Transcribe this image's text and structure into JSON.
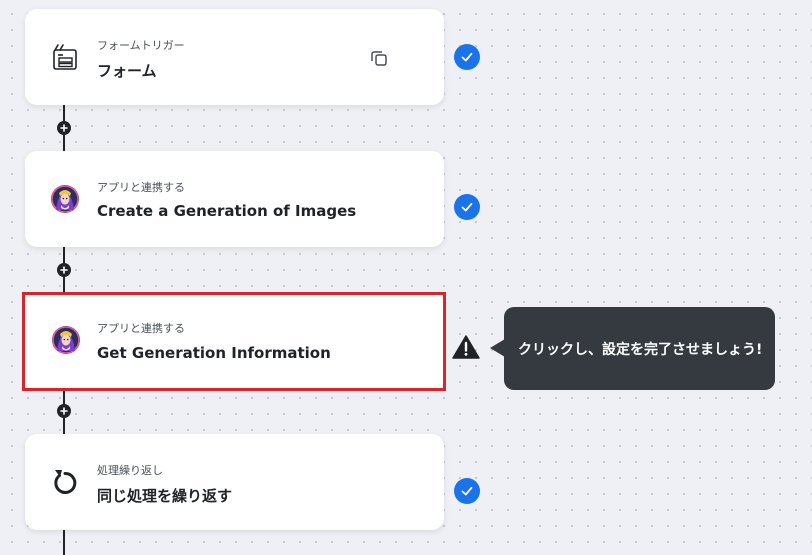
{
  "steps": [
    {
      "subtitle": "フォームトリガー",
      "title": "フォーム",
      "icon": "form-trigger-icon",
      "status": "complete"
    },
    {
      "subtitle": "アプリと連携する",
      "title": "Create a Generation of Images",
      "icon": "app-avatar-icon",
      "status": "complete"
    },
    {
      "subtitle": "アプリと連携する",
      "title": "Get Generation Information",
      "icon": "app-avatar-icon",
      "status": "warning"
    },
    {
      "subtitle": "処理繰り返し",
      "title": "同じ処理を繰り返す",
      "icon": "loop-icon",
      "status": "complete"
    }
  ],
  "tooltip": {
    "text": "クリックし、設定を完了させましょう!"
  },
  "colors": {
    "accent": "#1a73e8",
    "selected_border": "#d7262b",
    "tooltip_bg": "#353a40",
    "connector": "#1f2328"
  }
}
